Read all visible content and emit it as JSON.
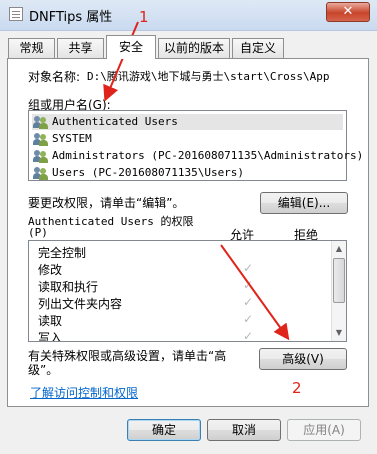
{
  "window": {
    "title": "DNFTips 属性",
    "close_glyph": "✕"
  },
  "tabs": [
    {
      "label": "常规"
    },
    {
      "label": "共享"
    },
    {
      "label": "安全"
    },
    {
      "label": "以前的版本"
    },
    {
      "label": "自定义"
    }
  ],
  "security": {
    "object_label": "对象名称:",
    "object_name": "D:\\腾讯游戏\\地下城与勇士\\start\\Cross\\App",
    "groups_label": "组或用户名(G):",
    "groups": [
      {
        "name": "Authenticated Users"
      },
      {
        "name": "SYSTEM"
      },
      {
        "name": "Administrators (PC-201608071135\\Administrators)"
      },
      {
        "name": "Users (PC-201608071135\\Users)"
      }
    ],
    "change_text": "要更改权限，请单击“编辑”。",
    "edit_button": "编辑(E)...",
    "perm_header": "Authenticated Users 的权限",
    "perm_header_key": "(P)",
    "allow_header": "允许",
    "deny_header": "拒绝",
    "permissions": [
      {
        "name": "完全控制",
        "allow": false
      },
      {
        "name": "修改",
        "allow": true
      },
      {
        "name": "读取和执行",
        "allow": true
      },
      {
        "name": "列出文件夹内容",
        "allow": true
      },
      {
        "name": "读取",
        "allow": true
      },
      {
        "name": "写入",
        "allow": true
      }
    ],
    "special_text_line1": "有关特殊权限或高级设置，请单击“高",
    "special_text_line2": "级”。",
    "advanced_button": "高级(V)",
    "learn_link": "了解访问控制和权限"
  },
  "footer": {
    "ok": "确定",
    "cancel": "取消",
    "apply": "应用(A)"
  },
  "annotations": {
    "one": "1",
    "two": "2"
  },
  "colors": {
    "arrow": "#e0241b",
    "link": "#0066cc"
  }
}
